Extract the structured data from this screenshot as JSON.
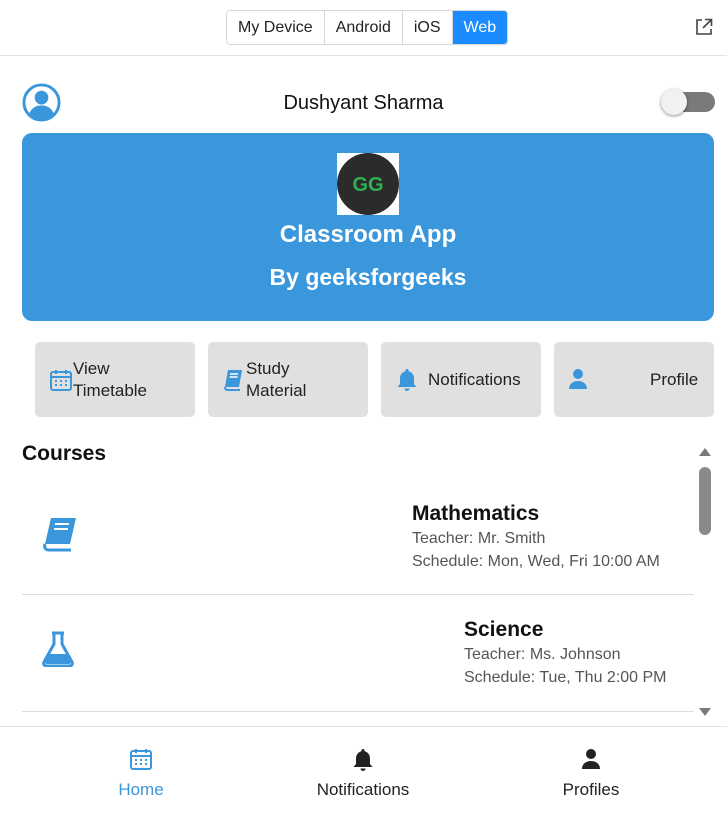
{
  "platform_tabs": [
    "My Device",
    "Android",
    "iOS",
    "Web"
  ],
  "active_platform": "Web",
  "header": {
    "user_name": "Dushyant Sharma",
    "dark_mode_on": false
  },
  "banner": {
    "title": "Classroom App",
    "subtitle": "By geeksforgeeks",
    "logo_text": "GG"
  },
  "quick_actions": [
    {
      "line1": "View",
      "line2": "Timetable",
      "icon": "calendar-icon"
    },
    {
      "line1": "Study",
      "line2": "Material",
      "icon": "book-icon"
    },
    {
      "line1": "Notifications",
      "line2": "",
      "icon": "bell-icon"
    },
    {
      "line1": "Profile",
      "line2": "",
      "icon": "user-icon"
    }
  ],
  "courses": {
    "title": "Courses",
    "items": [
      {
        "name": "Mathematics",
        "teacher": "Teacher: Mr. Smith",
        "schedule": "Schedule: Mon, Wed, Fri 10:00 AM",
        "icon": "book-icon"
      },
      {
        "name": "Science",
        "teacher": "Teacher: Ms. Johnson",
        "schedule": "Schedule: Tue, Thu 2:00 PM",
        "icon": "flask-icon"
      }
    ]
  },
  "bottom_nav": [
    {
      "label": "Home",
      "icon": "calendar-icon",
      "active": true
    },
    {
      "label": "Notifications",
      "icon": "bell-icon",
      "active": false
    },
    {
      "label": "Profiles",
      "icon": "user-icon",
      "active": false
    }
  ],
  "colors": {
    "accent": "#3a97db",
    "segment_active": "#1a8cff",
    "icon_blue": "#3a97db"
  }
}
